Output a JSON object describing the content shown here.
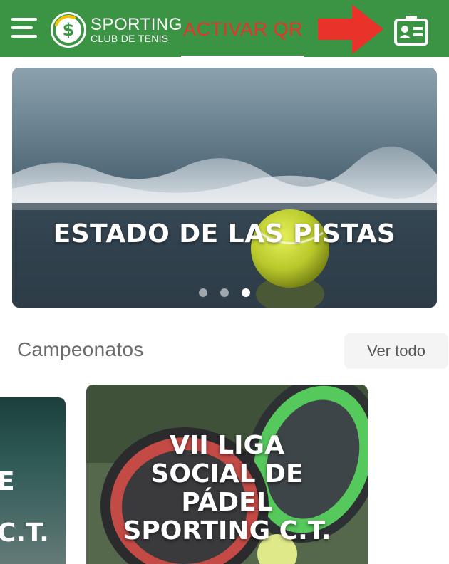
{
  "header": {
    "brand_name": "SPORTING",
    "brand_sub": "CLUB DE TENIS",
    "activar_label": "ACTIVAR QR",
    "colors": {
      "bar": "#3a9444",
      "activar": "#e8322a",
      "arrow": "#e8322a"
    },
    "icons": {
      "menu": "hamburger-menu-icon",
      "logo": "sporting-dollar-logo",
      "card": "id-card-icon"
    }
  },
  "hero": {
    "title": "ESTADO DE LAS PISTAS",
    "slide_count": 3,
    "active_slide": 3
  },
  "campeonatos": {
    "section_title": "Campeonatos",
    "see_all_label": "Ver todo",
    "cards": [
      {
        "title_lines": [
          "E",
          "C.T."
        ]
      },
      {
        "title_lines": [
          "VII LIGA",
          "SOCIAL DE",
          "PÁDEL",
          "SPORTING C.T."
        ]
      }
    ]
  }
}
